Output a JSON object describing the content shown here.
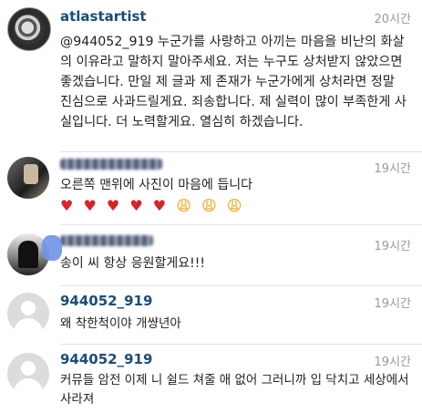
{
  "comments": [
    {
      "username": "atlastartist",
      "time": "20시간",
      "text": "@944052_919 누군가를 사랑하고 아끼는 마음을 비난의 화살의 이유라고 말하지 말아주세요. 저는 누구도 상처받지 않았으면 좋겠습니다. 만일 제 글과 제 존재가 누군가에게 상처라면 정말 진심으로 사과드릴게요. 죄송합니다. 제 실력이 많이 부족한게 사실입니다. 더 노력할게요. 열심히 하겠습니다."
    },
    {
      "username": "",
      "time": "19시간",
      "text": "오른쪽 맨위에 사진이 마음에 듭니다",
      "emojis": "♥ ♥ ♥ ♥ ♥ 😩 😩 😩"
    },
    {
      "username": "",
      "time": "19시간",
      "text": "송이 씨 항상 응원할게요!!!"
    },
    {
      "username": "944052_919",
      "time": "19시간",
      "text": "왜 착한척이야 개썅년아"
    },
    {
      "username": "944052_919",
      "time": "19시간",
      "text": "커뮤들 암전 이제 니 쉴드 쳐줄 애 없어 그러니까  입 닥치고 세상에서 사라져"
    }
  ],
  "icons": {
    "default_avatar": "person-silhouette",
    "heart_color": "#d8232a",
    "face_color": "#e8a317"
  }
}
